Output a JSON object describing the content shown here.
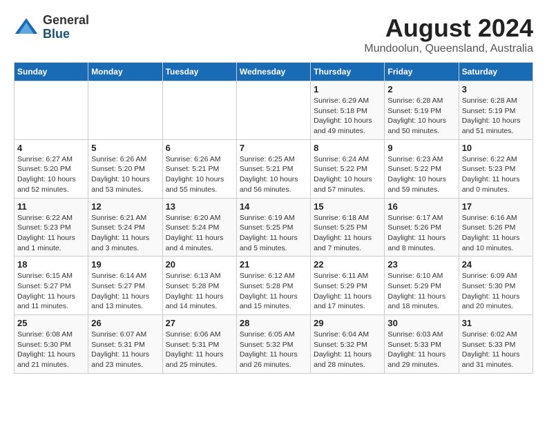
{
  "header": {
    "logo_line1": "General",
    "logo_line2": "Blue",
    "title": "August 2024",
    "subtitle": "Mundoolun, Queensland, Australia"
  },
  "days_of_week": [
    "Sunday",
    "Monday",
    "Tuesday",
    "Wednesday",
    "Thursday",
    "Friday",
    "Saturday"
  ],
  "weeks": [
    [
      {
        "day": "",
        "info": ""
      },
      {
        "day": "",
        "info": ""
      },
      {
        "day": "",
        "info": ""
      },
      {
        "day": "",
        "info": ""
      },
      {
        "day": "1",
        "info": "Sunrise: 6:29 AM\nSunset: 5:18 PM\nDaylight: 10 hours\nand 49 minutes."
      },
      {
        "day": "2",
        "info": "Sunrise: 6:28 AM\nSunset: 5:19 PM\nDaylight: 10 hours\nand 50 minutes."
      },
      {
        "day": "3",
        "info": "Sunrise: 6:28 AM\nSunset: 5:19 PM\nDaylight: 10 hours\nand 51 minutes."
      }
    ],
    [
      {
        "day": "4",
        "info": "Sunrise: 6:27 AM\nSunset: 5:20 PM\nDaylight: 10 hours\nand 52 minutes."
      },
      {
        "day": "5",
        "info": "Sunrise: 6:26 AM\nSunset: 5:20 PM\nDaylight: 10 hours\nand 53 minutes."
      },
      {
        "day": "6",
        "info": "Sunrise: 6:26 AM\nSunset: 5:21 PM\nDaylight: 10 hours\nand 55 minutes."
      },
      {
        "day": "7",
        "info": "Sunrise: 6:25 AM\nSunset: 5:21 PM\nDaylight: 10 hours\nand 56 minutes."
      },
      {
        "day": "8",
        "info": "Sunrise: 6:24 AM\nSunset: 5:22 PM\nDaylight: 10 hours\nand 57 minutes."
      },
      {
        "day": "9",
        "info": "Sunrise: 6:23 AM\nSunset: 5:22 PM\nDaylight: 10 hours\nand 59 minutes."
      },
      {
        "day": "10",
        "info": "Sunrise: 6:22 AM\nSunset: 5:23 PM\nDaylight: 11 hours\nand 0 minutes."
      }
    ],
    [
      {
        "day": "11",
        "info": "Sunrise: 6:22 AM\nSunset: 5:23 PM\nDaylight: 11 hours\nand 1 minute."
      },
      {
        "day": "12",
        "info": "Sunrise: 6:21 AM\nSunset: 5:24 PM\nDaylight: 11 hours\nand 3 minutes."
      },
      {
        "day": "13",
        "info": "Sunrise: 6:20 AM\nSunset: 5:24 PM\nDaylight: 11 hours\nand 4 minutes."
      },
      {
        "day": "14",
        "info": "Sunrise: 6:19 AM\nSunset: 5:25 PM\nDaylight: 11 hours\nand 5 minutes."
      },
      {
        "day": "15",
        "info": "Sunrise: 6:18 AM\nSunset: 5:25 PM\nDaylight: 11 hours\nand 7 minutes."
      },
      {
        "day": "16",
        "info": "Sunrise: 6:17 AM\nSunset: 5:26 PM\nDaylight: 11 hours\nand 8 minutes."
      },
      {
        "day": "17",
        "info": "Sunrise: 6:16 AM\nSunset: 5:26 PM\nDaylight: 11 hours\nand 10 minutes."
      }
    ],
    [
      {
        "day": "18",
        "info": "Sunrise: 6:15 AM\nSunset: 5:27 PM\nDaylight: 11 hours\nand 11 minutes."
      },
      {
        "day": "19",
        "info": "Sunrise: 6:14 AM\nSunset: 5:27 PM\nDaylight: 11 hours\nand 13 minutes."
      },
      {
        "day": "20",
        "info": "Sunrise: 6:13 AM\nSunset: 5:28 PM\nDaylight: 11 hours\nand 14 minutes."
      },
      {
        "day": "21",
        "info": "Sunrise: 6:12 AM\nSunset: 5:28 PM\nDaylight: 11 hours\nand 15 minutes."
      },
      {
        "day": "22",
        "info": "Sunrise: 6:11 AM\nSunset: 5:29 PM\nDaylight: 11 hours\nand 17 minutes."
      },
      {
        "day": "23",
        "info": "Sunrise: 6:10 AM\nSunset: 5:29 PM\nDaylight: 11 hours\nand 18 minutes."
      },
      {
        "day": "24",
        "info": "Sunrise: 6:09 AM\nSunset: 5:30 PM\nDaylight: 11 hours\nand 20 minutes."
      }
    ],
    [
      {
        "day": "25",
        "info": "Sunrise: 6:08 AM\nSunset: 5:30 PM\nDaylight: 11 hours\nand 21 minutes."
      },
      {
        "day": "26",
        "info": "Sunrise: 6:07 AM\nSunset: 5:31 PM\nDaylight: 11 hours\nand 23 minutes."
      },
      {
        "day": "27",
        "info": "Sunrise: 6:06 AM\nSunset: 5:31 PM\nDaylight: 11 hours\nand 25 minutes."
      },
      {
        "day": "28",
        "info": "Sunrise: 6:05 AM\nSunset: 5:32 PM\nDaylight: 11 hours\nand 26 minutes."
      },
      {
        "day": "29",
        "info": "Sunrise: 6:04 AM\nSunset: 5:32 PM\nDaylight: 11 hours\nand 28 minutes."
      },
      {
        "day": "30",
        "info": "Sunrise: 6:03 AM\nSunset: 5:33 PM\nDaylight: 11 hours\nand 29 minutes."
      },
      {
        "day": "31",
        "info": "Sunrise: 6:02 AM\nSunset: 5:33 PM\nDaylight: 11 hours\nand 31 minutes."
      }
    ]
  ]
}
